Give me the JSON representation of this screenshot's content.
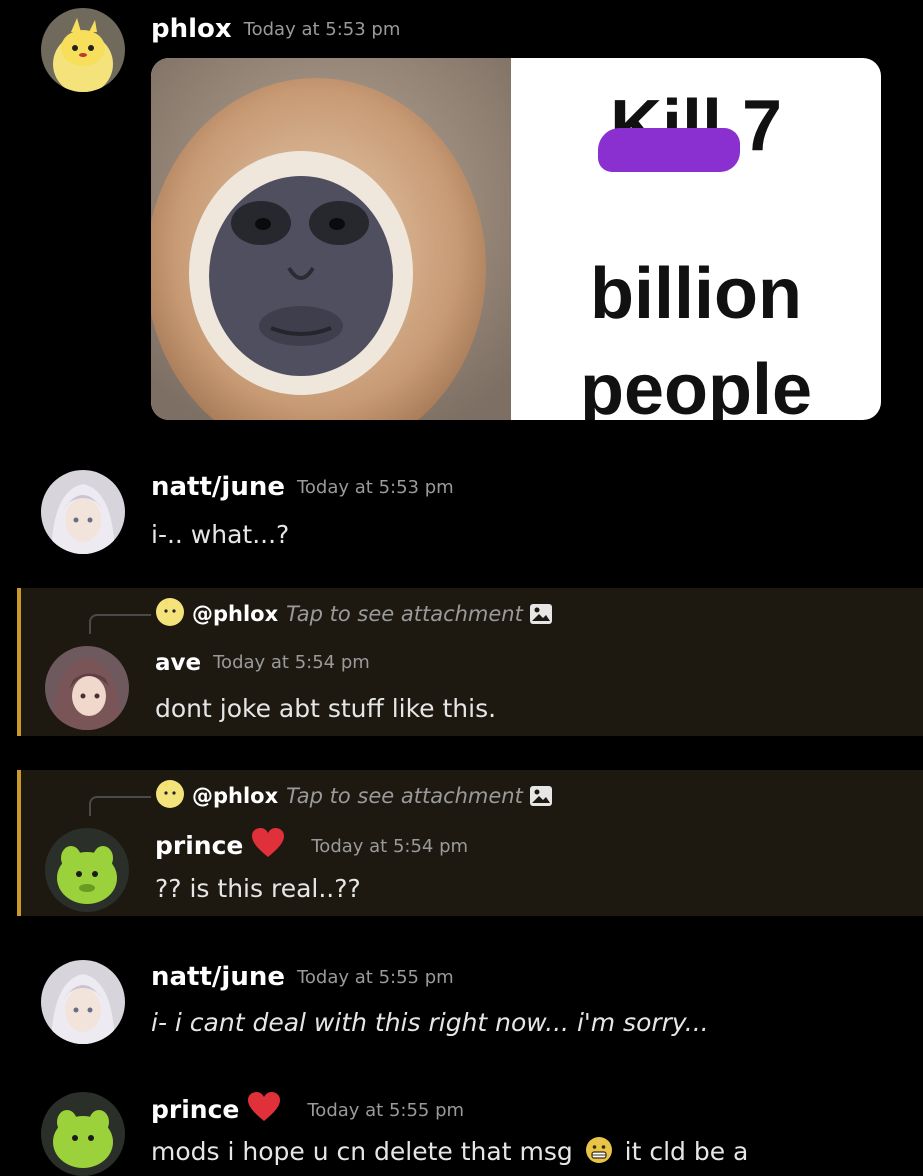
{
  "messages": [
    {
      "author": "phlox",
      "timestamp": "Today at 5:53 pm",
      "attachment": {
        "caption_line1_word": "Kill",
        "caption_line1_number": "7",
        "caption_line2": "billion",
        "caption_line3": "people",
        "redaction_color": "#8a2fd0"
      }
    },
    {
      "author": "natt/june",
      "timestamp": "Today at 5:53 pm",
      "content": "i-.. what...?"
    },
    {
      "reply_to": "@phlox",
      "reply_preview": "Tap to see attachment",
      "author": "ave",
      "timestamp": "Today at 5:54 pm",
      "content": "dont joke abt stuff like this."
    },
    {
      "reply_to": "@phlox",
      "reply_preview": "Tap to see attachment",
      "author": "prince",
      "timestamp": "Today at 5:54 pm",
      "content": "?? is this real..??"
    },
    {
      "author": "natt/june",
      "timestamp": "Today at 5:55 pm",
      "content": "i- i cant deal with this right now... i'm sorry..."
    },
    {
      "author": "prince",
      "timestamp": "Today at 5:55 pm",
      "content_before_emoji": "mods i hope u cn delete that msg",
      "content_after_emoji": "it cld be a"
    }
  ],
  "colors": {
    "background": "#000000",
    "reply_highlight": "#1d1911",
    "reply_border": "#c99a2a",
    "heart": "#e0303a"
  },
  "icons": {
    "role_badge": "heart-icon",
    "attachment": "image-icon",
    "emoji": "grimace-emoji"
  }
}
